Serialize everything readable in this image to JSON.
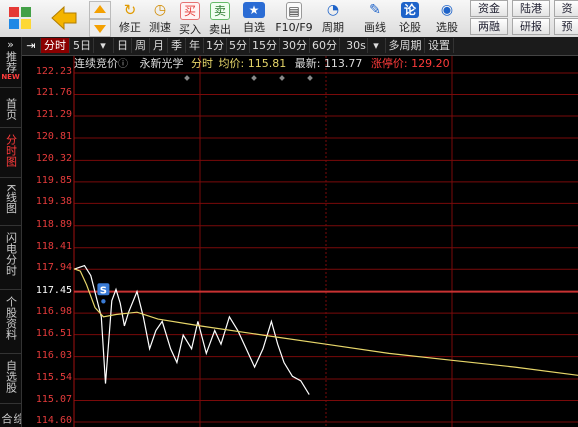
{
  "toolbar": {
    "items": [
      {
        "label": "修正",
        "icon": "refresh-icon"
      },
      {
        "label": "测速",
        "icon": "clock-icon"
      },
      {
        "label": "买入",
        "icon": "buy-icon",
        "glyph": "买"
      },
      {
        "label": "卖出",
        "icon": "sell-icon",
        "glyph": "卖"
      },
      {
        "label": "自选",
        "icon": "star-icon"
      },
      {
        "label": "F10/F9",
        "icon": "f10-icon"
      },
      {
        "label": "周期",
        "icon": "period-icon"
      },
      {
        "label": "画线",
        "icon": "pencil-icon"
      },
      {
        "label": "论股",
        "icon": "discuss-icon",
        "glyph": "论"
      },
      {
        "label": "选股",
        "icon": "select-stock-icon"
      }
    ],
    "right_buttons": [
      "资金",
      "陆港",
      "资",
      "两融",
      "研报",
      "预"
    ]
  },
  "left_tabs": [
    "推荐",
    "首页",
    "分时图",
    "K线图",
    "闪电分时",
    "个股资料",
    "自选股",
    "综合"
  ],
  "left_tabs_new_badge": "NEW",
  "periods": [
    "分时",
    "5日",
    "日",
    "周",
    "月",
    "季",
    "年",
    "1分",
    "5分",
    "15分",
    "30分",
    "60分",
    "30s",
    "多周期",
    "设置"
  ],
  "info": {
    "auction": "连续竞价",
    "name": "永新光学",
    "mode": "分时",
    "avg_label": "均价:",
    "avg_value": "115.81",
    "latest_label": "最新:",
    "latest_value": "113.77",
    "limit_label": "涨停价:",
    "limit_value": "129.20"
  },
  "chart_data": {
    "type": "line",
    "y_ticks": [
      "122.23",
      "121.76",
      "121.29",
      "120.81",
      "120.32",
      "119.85",
      "119.38",
      "118.89",
      "118.41",
      "117.94",
      "117.45",
      "116.98",
      "116.51",
      "116.03",
      "115.54",
      "115.07",
      "114.60"
    ],
    "ylim": [
      114.6,
      122.23
    ],
    "series": [
      {
        "name": "price",
        "color": "#ffffff",
        "x": [
          0,
          5,
          8,
          13,
          15,
          18,
          20,
          22,
          24,
          26,
          30,
          33,
          36,
          39,
          42,
          46,
          49,
          52,
          56,
          59,
          63,
          67,
          70,
          74,
          78,
          82,
          86,
          90,
          94,
          97,
          100,
          104,
          108,
          112
        ],
        "values": [
          117.94,
          118.02,
          117.8,
          116.9,
          115.44,
          117.25,
          117.5,
          117.2,
          116.7,
          117.0,
          117.45,
          116.9,
          116.2,
          116.6,
          116.8,
          116.2,
          115.9,
          116.5,
          116.2,
          116.8,
          116.1,
          116.6,
          116.3,
          116.9,
          116.6,
          116.2,
          115.8,
          116.2,
          116.8,
          116.3,
          115.9,
          115.6,
          115.5,
          115.2
        ]
      },
      {
        "name": "average",
        "color": "#e8d76a",
        "x": [
          0,
          3,
          6,
          10,
          14,
          20,
          30,
          40,
          60,
          90,
          120,
          150,
          180,
          210,
          240
        ],
        "values": [
          117.95,
          117.9,
          117.6,
          117.1,
          116.9,
          116.95,
          117.0,
          116.85,
          116.7,
          116.5,
          116.3,
          116.1,
          115.95,
          115.8,
          115.62
        ]
      }
    ],
    "marker": {
      "label": "S",
      "x": 14,
      "value": 117.48
    }
  }
}
